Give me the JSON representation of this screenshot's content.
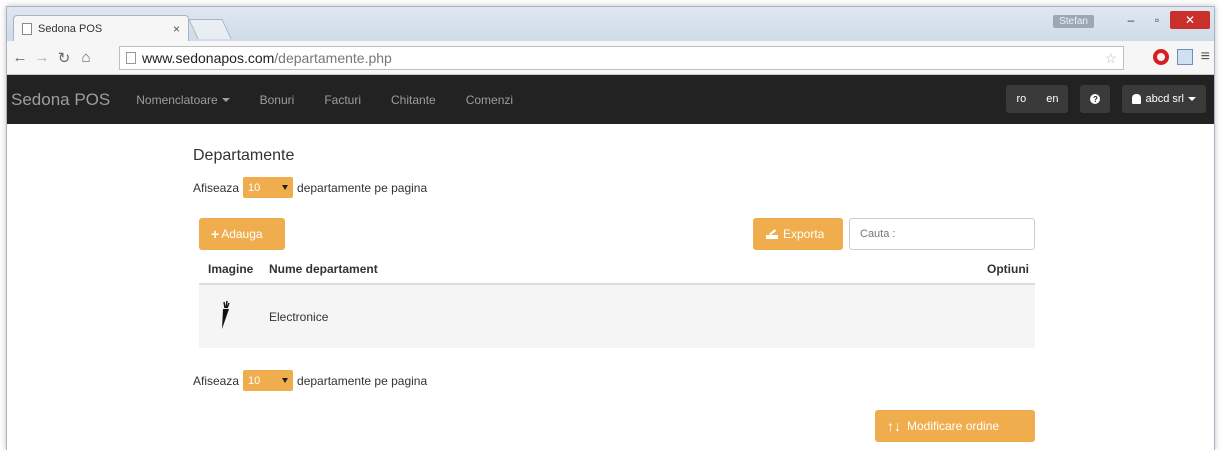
{
  "browser": {
    "tab_title": "Sedona POS",
    "tab_close": "×",
    "user_chip": "Stefan",
    "minimize": "–",
    "maximize": "▫",
    "close": "✕",
    "url_host": "www.sedonapos.com",
    "url_path": "/departamente.php"
  },
  "navbar": {
    "brand": "Sedona POS",
    "links": [
      "Nomenclatoare",
      "Bonuri",
      "Facturi",
      "Chitante",
      "Comenzi"
    ],
    "lang_ro": "ro",
    "lang_en": "en",
    "help": "?",
    "user": "abcd srl"
  },
  "page": {
    "title": "Departamente",
    "show_label": "Afiseaza",
    "per_page_value": "10",
    "per_page_suffix": "departamente pe pagina",
    "add_button": "Adauga",
    "export_button": "Exporta",
    "search_placeholder": "Cauta :",
    "order_button": "Modificare ordine"
  },
  "table": {
    "headers": {
      "image": "Imagine",
      "name": "Nume departament",
      "options": "Optiuni"
    },
    "rows": [
      {
        "name": "Electronice",
        "icon": "carrot-icon"
      }
    ]
  },
  "colors": {
    "accent": "#f0ad4e",
    "navbar": "#222222"
  }
}
